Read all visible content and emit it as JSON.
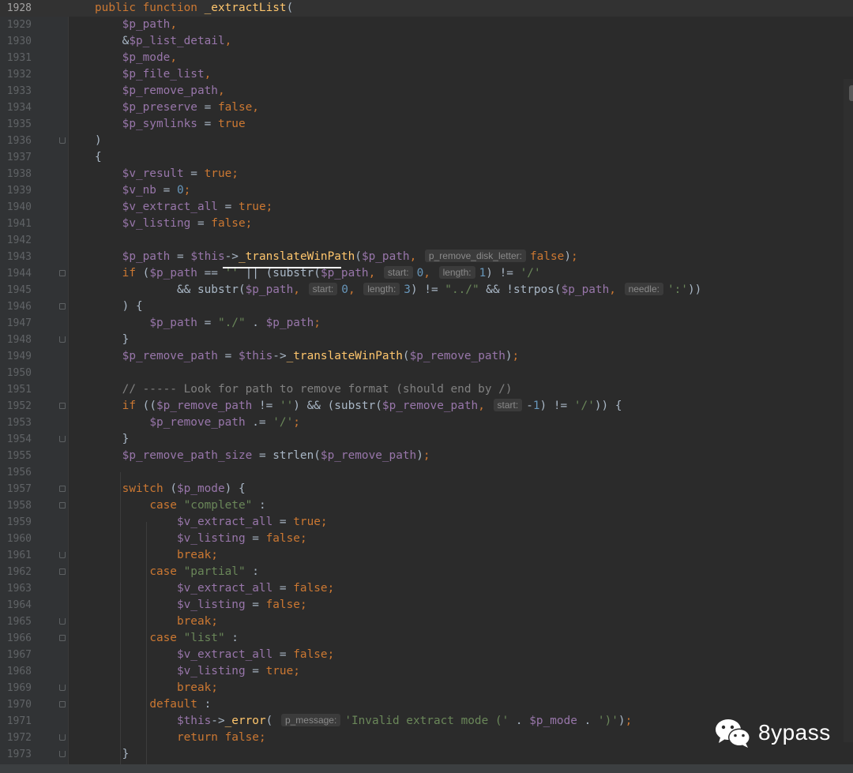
{
  "editor": {
    "lines": [
      {
        "n": "1928",
        "current": true,
        "fold": "",
        "tokens": [
          [
            "k",
            "public function "
          ],
          [
            "f",
            "_extractList"
          ],
          [
            "p",
            "("
          ]
        ]
      },
      {
        "n": "1929",
        "fold": "",
        "tokens": [
          [
            "p",
            "    "
          ],
          [
            "v",
            "$p_path"
          ],
          [
            "k",
            ","
          ]
        ]
      },
      {
        "n": "1930",
        "fold": "",
        "tokens": [
          [
            "p",
            "    &"
          ],
          [
            "v",
            "$p_list_detail"
          ],
          [
            "k",
            ","
          ]
        ]
      },
      {
        "n": "1931",
        "fold": "",
        "tokens": [
          [
            "p",
            "    "
          ],
          [
            "v",
            "$p_mode"
          ],
          [
            "k",
            ","
          ]
        ]
      },
      {
        "n": "1932",
        "fold": "",
        "tokens": [
          [
            "p",
            "    "
          ],
          [
            "v",
            "$p_file_list"
          ],
          [
            "k",
            ","
          ]
        ]
      },
      {
        "n": "1933",
        "fold": "",
        "tokens": [
          [
            "p",
            "    "
          ],
          [
            "v",
            "$p_remove_path"
          ],
          [
            "k",
            ","
          ]
        ]
      },
      {
        "n": "1934",
        "fold": "",
        "tokens": [
          [
            "p",
            "    "
          ],
          [
            "v",
            "$p_preserve"
          ],
          [
            "p",
            " = "
          ],
          [
            "k",
            "false"
          ],
          [
            "k",
            ","
          ]
        ]
      },
      {
        "n": "1935",
        "fold": "",
        "tokens": [
          [
            "p",
            "    "
          ],
          [
            "v",
            "$p_symlinks"
          ],
          [
            "p",
            " = "
          ],
          [
            "k",
            "true"
          ]
        ]
      },
      {
        "n": "1936",
        "fold": "end",
        "tokens": [
          [
            "p",
            ")"
          ]
        ]
      },
      {
        "n": "1937",
        "fold": "",
        "tokens": [
          [
            "p",
            "{"
          ]
        ]
      },
      {
        "n": "1938",
        "fold": "",
        "tokens": [
          [
            "p",
            "    "
          ],
          [
            "v",
            "$v_result"
          ],
          [
            "p",
            " = "
          ],
          [
            "k",
            "true"
          ],
          [
            "k",
            ";"
          ]
        ]
      },
      {
        "n": "1939",
        "fold": "",
        "tokens": [
          [
            "p",
            "    "
          ],
          [
            "v",
            "$v_nb"
          ],
          [
            "p",
            " = "
          ],
          [
            "n",
            "0"
          ],
          [
            "k",
            ";"
          ]
        ]
      },
      {
        "n": "1940",
        "fold": "",
        "tokens": [
          [
            "p",
            "    "
          ],
          [
            "v",
            "$v_extract_all"
          ],
          [
            "p",
            " = "
          ],
          [
            "k",
            "true"
          ],
          [
            "k",
            ";"
          ]
        ]
      },
      {
        "n": "1941",
        "fold": "",
        "tokens": [
          [
            "p",
            "    "
          ],
          [
            "v",
            "$v_listing"
          ],
          [
            "p",
            " = "
          ],
          [
            "k",
            "false"
          ],
          [
            "k",
            ";"
          ]
        ]
      },
      {
        "n": "1942",
        "fold": "",
        "tokens": []
      },
      {
        "n": "1943",
        "fold": "",
        "tokens": [
          [
            "p",
            "    "
          ],
          [
            "v",
            "$p_path"
          ],
          [
            "p",
            " = "
          ],
          [
            "v",
            "$this"
          ],
          [
            "p",
            "->"
          ],
          [
            "f",
            "_translateWinPath"
          ],
          [
            "p",
            "("
          ],
          [
            "v",
            "$p_path"
          ],
          [
            "k",
            ", "
          ],
          [
            "h",
            "p_remove_disk_letter:"
          ],
          [
            "k",
            "false"
          ],
          [
            "p",
            ")"
          ],
          [
            "k",
            ";"
          ]
        ]
      },
      {
        "n": "1944",
        "fold": "start",
        "tokens": [
          [
            "p",
            "    "
          ],
          [
            "k",
            "if "
          ],
          [
            "p",
            "("
          ],
          [
            "v",
            "$p_path"
          ],
          [
            "p",
            " == "
          ],
          [
            "s",
            "''"
          ],
          [
            "p",
            " || (substr("
          ],
          [
            "v",
            "$p_path"
          ],
          [
            "k",
            ", "
          ],
          [
            "h",
            "start:"
          ],
          [
            "n",
            "0"
          ],
          [
            "k",
            ", "
          ],
          [
            "h",
            "length:"
          ],
          [
            "n",
            "1"
          ],
          [
            "p",
            ") != "
          ],
          [
            "s",
            "'/'"
          ]
        ]
      },
      {
        "n": "1945",
        "fold": "",
        "tokens": [
          [
            "p",
            "            && substr("
          ],
          [
            "v",
            "$p_path"
          ],
          [
            "k",
            ", "
          ],
          [
            "h",
            "start:"
          ],
          [
            "n",
            "0"
          ],
          [
            "k",
            ", "
          ],
          [
            "h",
            "length:"
          ],
          [
            "n",
            "3"
          ],
          [
            "p",
            ") != "
          ],
          [
            "s",
            "\"../\""
          ],
          [
            "p",
            " && !strpos("
          ],
          [
            "v",
            "$p_path"
          ],
          [
            "k",
            ", "
          ],
          [
            "h",
            "needle:"
          ],
          [
            "s",
            "':'"
          ],
          [
            "p",
            "))"
          ]
        ]
      },
      {
        "n": "1946",
        "fold": "start",
        "tokens": [
          [
            "p",
            "    ) {"
          ]
        ]
      },
      {
        "n": "1947",
        "fold": "",
        "tokens": [
          [
            "p",
            "        "
          ],
          [
            "v",
            "$p_path"
          ],
          [
            "p",
            " = "
          ],
          [
            "s",
            "\"./\""
          ],
          [
            "p",
            " . "
          ],
          [
            "v",
            "$p_path"
          ],
          [
            "k",
            ";"
          ]
        ]
      },
      {
        "n": "1948",
        "fold": "end",
        "tokens": [
          [
            "p",
            "    }"
          ]
        ]
      },
      {
        "n": "1949",
        "fold": "",
        "tokens": [
          [
            "p",
            "    "
          ],
          [
            "v",
            "$p_remove_path"
          ],
          [
            "p",
            " = "
          ],
          [
            "v",
            "$this"
          ],
          [
            "p",
            "->"
          ],
          [
            "f",
            "_translateWinPath"
          ],
          [
            "p",
            "("
          ],
          [
            "v",
            "$p_remove_path"
          ],
          [
            "p",
            ")"
          ],
          [
            "k",
            ";"
          ]
        ]
      },
      {
        "n": "1950",
        "fold": "",
        "tokens": []
      },
      {
        "n": "1951",
        "fold": "",
        "tokens": [
          [
            "c",
            "    // ----- Look for path to remove format (should end by /)"
          ]
        ]
      },
      {
        "n": "1952",
        "fold": "start",
        "tokens": [
          [
            "p",
            "    "
          ],
          [
            "k",
            "if "
          ],
          [
            "p",
            "(("
          ],
          [
            "v",
            "$p_remove_path"
          ],
          [
            "p",
            " != "
          ],
          [
            "s",
            "''"
          ],
          [
            "p",
            ") && (substr("
          ],
          [
            "v",
            "$p_remove_path"
          ],
          [
            "k",
            ", "
          ],
          [
            "h",
            "start:"
          ],
          [
            "p",
            "-"
          ],
          [
            "n",
            "1"
          ],
          [
            "p",
            ") != "
          ],
          [
            "s",
            "'/'"
          ],
          [
            "p",
            ")) {"
          ]
        ]
      },
      {
        "n": "1953",
        "fold": "",
        "tokens": [
          [
            "p",
            "        "
          ],
          [
            "v",
            "$p_remove_path"
          ],
          [
            "p",
            " .= "
          ],
          [
            "s",
            "'/'"
          ],
          [
            "k",
            ";"
          ]
        ]
      },
      {
        "n": "1954",
        "fold": "end",
        "tokens": [
          [
            "p",
            "    }"
          ]
        ]
      },
      {
        "n": "1955",
        "fold": "",
        "tokens": [
          [
            "p",
            "    "
          ],
          [
            "v",
            "$p_remove_path_size"
          ],
          [
            "p",
            " = strlen("
          ],
          [
            "v",
            "$p_remove_path"
          ],
          [
            "p",
            ")"
          ],
          [
            "k",
            ";"
          ]
        ]
      },
      {
        "n": "1956",
        "fold": "",
        "tokens": []
      },
      {
        "n": "1957",
        "fold": "start",
        "tokens": [
          [
            "p",
            "    "
          ],
          [
            "k",
            "switch "
          ],
          [
            "p",
            "("
          ],
          [
            "v",
            "$p_mode"
          ],
          [
            "p",
            ") {"
          ]
        ]
      },
      {
        "n": "1958",
        "fold": "start",
        "tokens": [
          [
            "p",
            "        "
          ],
          [
            "k",
            "case "
          ],
          [
            "s",
            "\"complete\""
          ],
          [
            "p",
            " :"
          ]
        ]
      },
      {
        "n": "1959",
        "fold": "",
        "tokens": [
          [
            "p",
            "            "
          ],
          [
            "v",
            "$v_extract_all"
          ],
          [
            "p",
            " = "
          ],
          [
            "k",
            "true"
          ],
          [
            "k",
            ";"
          ]
        ]
      },
      {
        "n": "1960",
        "fold": "",
        "tokens": [
          [
            "p",
            "            "
          ],
          [
            "v",
            "$v_listing"
          ],
          [
            "p",
            " = "
          ],
          [
            "k",
            "false"
          ],
          [
            "k",
            ";"
          ]
        ]
      },
      {
        "n": "1961",
        "fold": "end",
        "tokens": [
          [
            "p",
            "            "
          ],
          [
            "k",
            "break"
          ],
          [
            "k",
            ";"
          ]
        ]
      },
      {
        "n": "1962",
        "fold": "start",
        "tokens": [
          [
            "p",
            "        "
          ],
          [
            "k",
            "case "
          ],
          [
            "s",
            "\"partial\""
          ],
          [
            "p",
            " :"
          ]
        ]
      },
      {
        "n": "1963",
        "fold": "",
        "tokens": [
          [
            "p",
            "            "
          ],
          [
            "v",
            "$v_extract_all"
          ],
          [
            "p",
            " = "
          ],
          [
            "k",
            "false"
          ],
          [
            "k",
            ";"
          ]
        ]
      },
      {
        "n": "1964",
        "fold": "",
        "tokens": [
          [
            "p",
            "            "
          ],
          [
            "v",
            "$v_listing"
          ],
          [
            "p",
            " = "
          ],
          [
            "k",
            "false"
          ],
          [
            "k",
            ";"
          ]
        ]
      },
      {
        "n": "1965",
        "fold": "end",
        "tokens": [
          [
            "p",
            "            "
          ],
          [
            "k",
            "break"
          ],
          [
            "k",
            ";"
          ]
        ]
      },
      {
        "n": "1966",
        "fold": "start",
        "tokens": [
          [
            "p",
            "        "
          ],
          [
            "k",
            "case "
          ],
          [
            "s",
            "\"list\""
          ],
          [
            "p",
            " :"
          ]
        ]
      },
      {
        "n": "1967",
        "fold": "",
        "tokens": [
          [
            "p",
            "            "
          ],
          [
            "v",
            "$v_extract_all"
          ],
          [
            "p",
            " = "
          ],
          [
            "k",
            "false"
          ],
          [
            "k",
            ";"
          ]
        ]
      },
      {
        "n": "1968",
        "fold": "",
        "tokens": [
          [
            "p",
            "            "
          ],
          [
            "v",
            "$v_listing"
          ],
          [
            "p",
            " = "
          ],
          [
            "k",
            "true"
          ],
          [
            "k",
            ";"
          ]
        ]
      },
      {
        "n": "1969",
        "fold": "end",
        "tokens": [
          [
            "p",
            "            "
          ],
          [
            "k",
            "break"
          ],
          [
            "k",
            ";"
          ]
        ]
      },
      {
        "n": "1970",
        "fold": "start",
        "tokens": [
          [
            "p",
            "        "
          ],
          [
            "k",
            "default"
          ],
          [
            "p",
            " :"
          ]
        ]
      },
      {
        "n": "1971",
        "fold": "",
        "tokens": [
          [
            "p",
            "            "
          ],
          [
            "v",
            "$this"
          ],
          [
            "p",
            "->"
          ],
          [
            "f",
            "_error"
          ],
          [
            "p",
            "( "
          ],
          [
            "h",
            "p_message:"
          ],
          [
            "s",
            "'Invalid extract mode ('"
          ],
          [
            "p",
            " . "
          ],
          [
            "v",
            "$p_mode"
          ],
          [
            "p",
            " . "
          ],
          [
            "s",
            "')'"
          ],
          [
            "p",
            ")"
          ],
          [
            "k",
            ";"
          ]
        ]
      },
      {
        "n": "1972",
        "fold": "end",
        "tokens": [
          [
            "p",
            "            "
          ],
          [
            "k",
            "return false"
          ],
          [
            "k",
            ";"
          ]
        ]
      },
      {
        "n": "1973",
        "fold": "end",
        "tokens": [
          [
            "p",
            "    }"
          ]
        ]
      }
    ]
  },
  "watermark": {
    "icon": "wechat-icon",
    "text": "8ypass"
  },
  "colors": {
    "background": "#2b2b2b",
    "gutter": "#313335",
    "keyword": "#cc7832",
    "variable": "#9876aa",
    "function": "#ffc66d",
    "number": "#6897bb",
    "string": "#6a8759",
    "comment": "#808080",
    "text": "#a9b7c6"
  }
}
